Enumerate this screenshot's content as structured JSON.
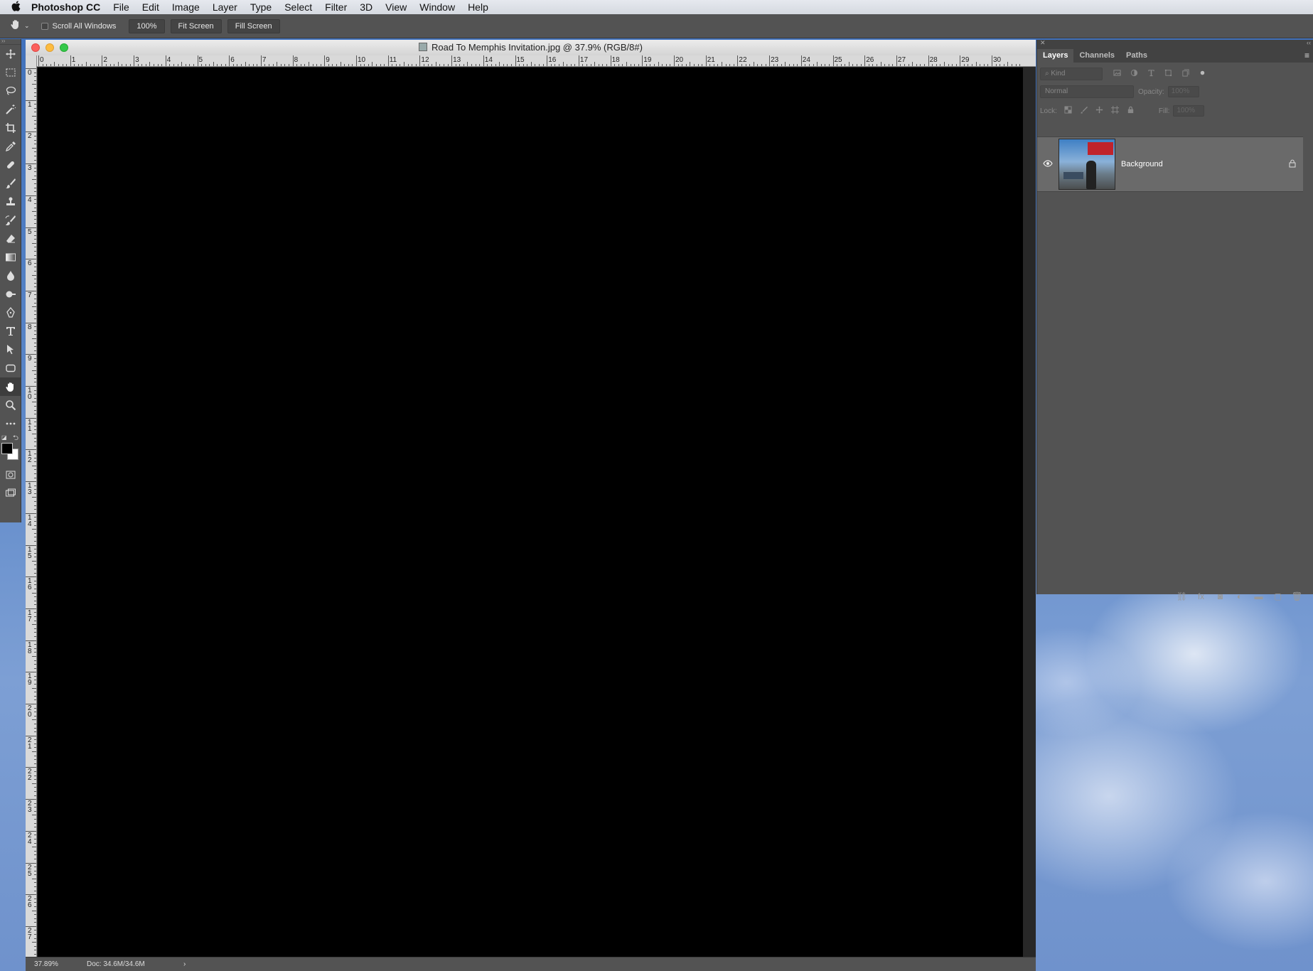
{
  "menubar": {
    "apple_icon": "apple-icon",
    "app_name": "Photoshop CC",
    "items": [
      "File",
      "Edit",
      "Image",
      "Layer",
      "Type",
      "Select",
      "Filter",
      "3D",
      "View",
      "Window",
      "Help"
    ]
  },
  "options_bar": {
    "tool_icon": "hand-icon",
    "scroll_all_windows": "Scroll All Windows",
    "scroll_all_checked": false,
    "zoom_100": "100%",
    "fit_screen": "Fit Screen",
    "fill_screen": "Fill Screen"
  },
  "tools": [
    "move-icon",
    "marquee-icon",
    "lasso-icon",
    "magic-wand-icon",
    "crop-icon",
    "eyedropper-icon",
    "healing-brush-icon",
    "brush-icon",
    "clone-stamp-icon",
    "history-brush-icon",
    "eraser-icon",
    "gradient-icon",
    "blur-icon",
    "dodge-icon",
    "pen-icon",
    "type-icon",
    "path-selection-icon",
    "rectangle-icon",
    "hand-icon",
    "zoom-icon",
    "more-icon"
  ],
  "active_tool": "hand-icon",
  "colors": {
    "foreground": "#000000",
    "background": "#ffffff"
  },
  "document": {
    "title": "Road To Memphis Invitation.jpg @ 37.9% (RGB/8#)",
    "zoom_status": "37.89%",
    "doc_size": "Doc: 34.6M/34.6M",
    "status_arrow": "›",
    "h_ruler": [
      "0",
      "1",
      "2",
      "3",
      "4",
      "5",
      "6",
      "7",
      "8",
      "9",
      "10",
      "11",
      "12",
      "13",
      "14",
      "15",
      "16",
      "17",
      "18",
      "19",
      "20",
      "21",
      "22",
      "23",
      "24",
      "25",
      "26",
      "27",
      "28",
      "29",
      "30"
    ],
    "v_ruler": [
      "0",
      "1",
      "2",
      "3",
      "4",
      "5",
      "6",
      "7",
      "8",
      "9",
      "10",
      "11",
      "12",
      "13",
      "14",
      "15",
      "16",
      "17",
      "18",
      "19",
      "20",
      "21",
      "22",
      "23",
      "24",
      "25",
      "26",
      "27"
    ],
    "canvas_color": "#000000"
  },
  "layers_panel": {
    "tabs": [
      "Layers",
      "Channels",
      "Paths"
    ],
    "active_tab": "Layers",
    "filter_kind": "Kind",
    "blend_mode": "Normal",
    "opacity_label": "Opacity:",
    "opacity_value": "100%",
    "lock_label": "Lock:",
    "fill_label": "Fill:",
    "fill_value": "100%",
    "layers": [
      {
        "name": "Background",
        "visible": true,
        "locked": true
      }
    ],
    "footer_icons": [
      "link-icon",
      "fx-icon",
      "mask-icon",
      "adjustment-icon",
      "folder-icon",
      "new-layer-icon",
      "trash-icon"
    ],
    "footer_glyphs": [
      "⛓",
      "fx",
      "◙",
      "◐",
      "▬",
      "▢",
      "🗑"
    ]
  }
}
